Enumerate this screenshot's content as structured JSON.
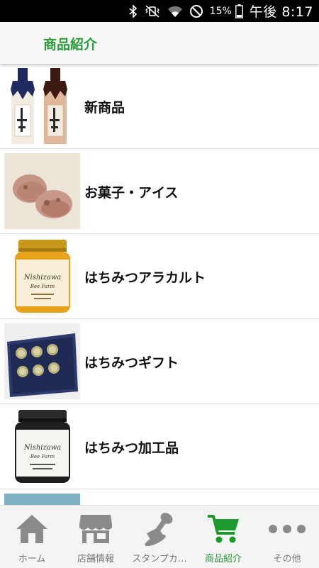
{
  "status_bar": {
    "battery": "15%",
    "time": "午後 8:17"
  },
  "header": {
    "title": "商品紹介"
  },
  "categories": [
    {
      "label": "新商品",
      "image": "sake-bottles-photo"
    },
    {
      "label": "お菓子・アイス",
      "image": "cookies-photo"
    },
    {
      "label": "はちみつアラカルト",
      "image": "honey-jar-photo"
    },
    {
      "label": "はちみつギフト",
      "image": "honey-gift-box-photo"
    },
    {
      "label": "はちみつ加工品",
      "image": "dark-honey-jar-photo"
    }
  ],
  "jar_label": {
    "brand": "Nishizawa",
    "sub": "Bee Farm"
  },
  "tabs": [
    {
      "label": "ホーム",
      "icon": "home-icon",
      "active": false
    },
    {
      "label": "店舗情報",
      "icon": "store-icon",
      "active": false
    },
    {
      "label": "スタンプカ…",
      "icon": "stamp-icon",
      "active": false
    },
    {
      "label": "商品紹介",
      "icon": "cart-icon",
      "active": true
    },
    {
      "label": "その他",
      "icon": "more-icon",
      "active": false
    }
  ],
  "colors": {
    "accent": "#1c9a2e",
    "header_title": "#2a9a3a",
    "inactive_icon": "#8a8a8a"
  }
}
